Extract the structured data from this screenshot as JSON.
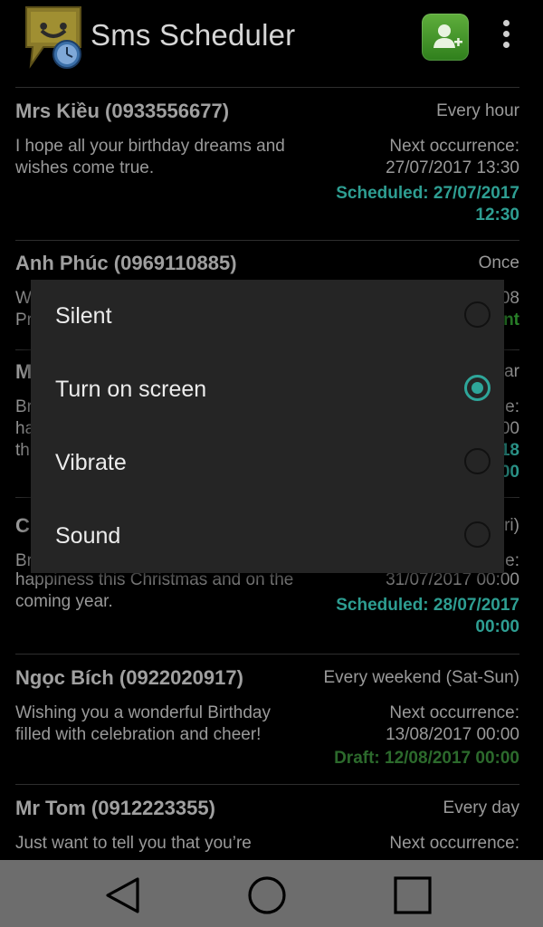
{
  "app": {
    "title": "Sms Scheduler",
    "logo_icon": "chat-clock-icon",
    "contacts_icon": "contacts-icon",
    "overflow_icon": "more-vert-icon"
  },
  "messages": [
    {
      "contact": "Mrs Kiều (0933556677)",
      "repeat": "Every hour",
      "text": "I hope all your birthday dreams and wishes come true.",
      "next_label": "Next occurrence:",
      "next_value": "27/07/2017 13:30",
      "status": "Scheduled: 27/07/2017 12:30",
      "status_type": "scheduled"
    },
    {
      "contact": "Anh Phúc (0969110885)",
      "repeat": "Once",
      "text_visible_1": "W",
      "text_visible_2": "Pr",
      "right_visible_1": "08",
      "status_visible": "nt"
    },
    {
      "contact_visible": "M",
      "repeat_visible": "ar",
      "text_visible": [
        "Br",
        "ha",
        "th"
      ],
      "right_visible": [
        "e:",
        "00",
        "18",
        "00"
      ]
    },
    {
      "contact_visible": "C",
      "repeat_visible": "ri)",
      "text_visible_1": "Br",
      "right_visible_1": "e:",
      "text": "happiness this Christmas and on the coming year.",
      "next_value": "31/07/2017 00:00",
      "status": "Scheduled: 28/07/2017 00:00",
      "status_type": "scheduled"
    },
    {
      "contact": "Ngọc Bích (0922020917)",
      "repeat": "Every weekend (Sat-Sun)",
      "text": "Wishing you a wonderful Birthday filled with celebration and cheer!",
      "next_label": "Next occurrence:",
      "next_value": "13/08/2017 00:00",
      "status": "Draft: 12/08/2017 00:00",
      "status_type": "draft"
    },
    {
      "contact": "Mr Tom (0912223355)",
      "repeat": "Every day",
      "text": "Just want to tell you that you’re",
      "next_label": "Next occurrence:"
    }
  ],
  "dialog": {
    "options": [
      {
        "label": "Silent",
        "selected": false
      },
      {
        "label": "Turn on screen",
        "selected": true
      },
      {
        "label": "Vibrate",
        "selected": false
      },
      {
        "label": "Sound",
        "selected": false
      }
    ]
  },
  "navbar": {
    "back_icon": "back-triangle-icon",
    "home_icon": "home-circle-icon",
    "recents_icon": "recents-square-icon"
  },
  "colors": {
    "accent": "#2ea69a",
    "scheduled": "#2e9e92",
    "draft": "#2c6a2c",
    "background": "#000000",
    "dialog": "#252525",
    "navbar": "#6d6d6d"
  }
}
